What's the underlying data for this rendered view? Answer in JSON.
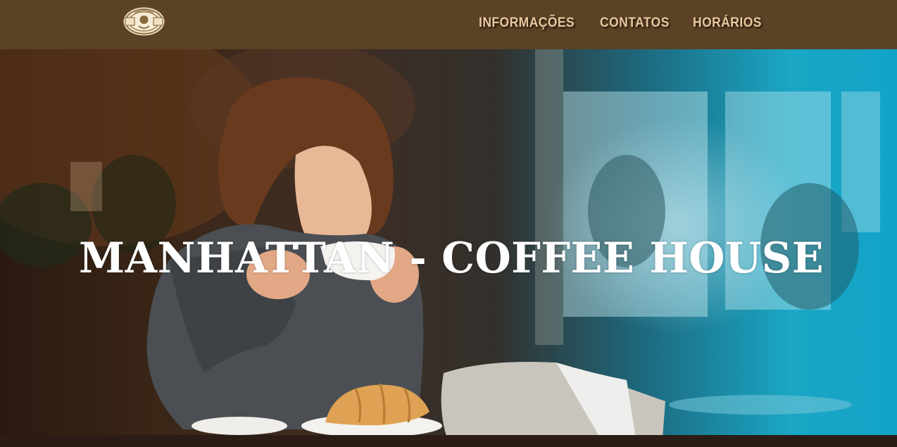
{
  "header": {
    "logo_icon": "coffee-house-seal-icon",
    "nav": [
      {
        "label": "INFORMAÇÕES"
      },
      {
        "label": "CONTATOS"
      },
      {
        "label": "HORÁRIOS"
      }
    ]
  },
  "hero": {
    "title": "MANHATTAN - COFFEE HOUSE"
  },
  "colors": {
    "header_bg": "#5b4125",
    "nav_text": "#e6c79e",
    "title_text": "#ffffff"
  }
}
